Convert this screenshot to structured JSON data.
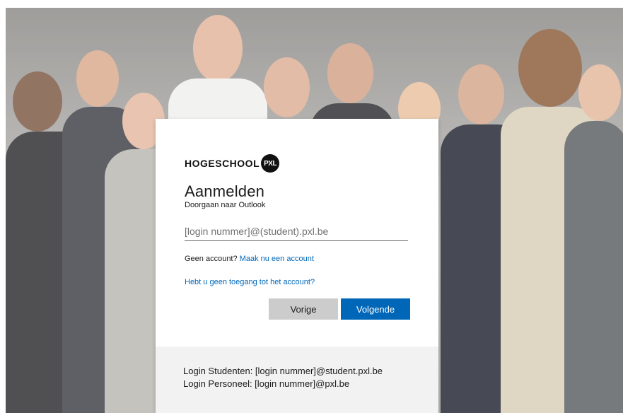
{
  "brand": {
    "name": "HOGESCHOOL",
    "badge": "PXL"
  },
  "signin": {
    "title": "Aanmelden",
    "subtitle": "Doorgaan naar Outlook",
    "input_placeholder": "[login nummer]@(student).pxl.be",
    "input_value": "",
    "no_account_prefix": "Geen account?",
    "create_account_link": "Maak nu een account",
    "no_access_link": "Hebt u geen toegang tot het account?",
    "back_button": "Vorige",
    "next_button": "Volgende"
  },
  "footer": {
    "line1": "Login Studenten: [login nummer]@student.pxl.be",
    "line2": "Login Personeel: [login nummer]@pxl.be"
  },
  "colors": {
    "accent": "#0067b8",
    "secondary_button": "#cccccc",
    "footer_bg": "#f2f2f2"
  }
}
